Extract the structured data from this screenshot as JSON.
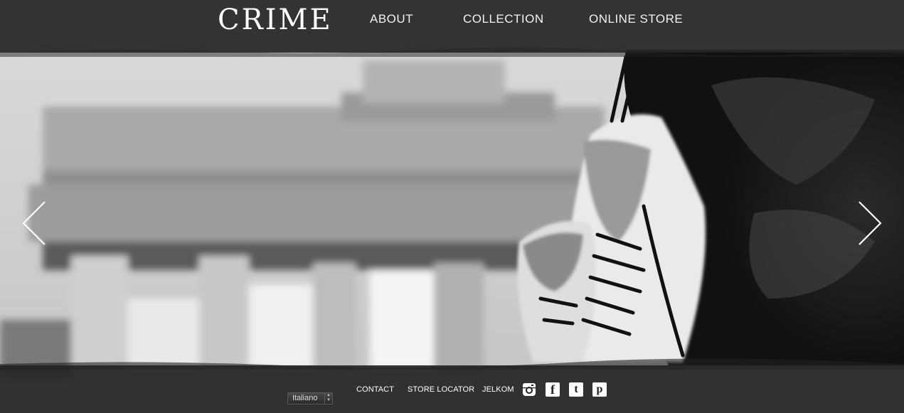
{
  "brand": {
    "logo_text": "CRIME"
  },
  "nav": {
    "items": [
      {
        "label": "ABOUT"
      },
      {
        "label": "COLLECTION"
      },
      {
        "label": "ONLINE STORE"
      }
    ]
  },
  "hero": {
    "image_description_icon": "photo-sneakers-brandenburg-gate",
    "prev_icon": "chevron-left-icon",
    "next_icon": "chevron-right-icon"
  },
  "footer": {
    "language_selected": "Italiano",
    "links": [
      {
        "label": "CONTACT"
      },
      {
        "label": "STORE LOCATOR"
      },
      {
        "label": "JELKOM"
      }
    ],
    "social": [
      {
        "icon": "instagram-icon"
      },
      {
        "icon": "facebook-icon",
        "glyph": "f"
      },
      {
        "icon": "twitter-icon",
        "glyph": "t"
      },
      {
        "icon": "pinterest-icon",
        "glyph": "p"
      }
    ]
  },
  "colors": {
    "bar": "#262626",
    "text": "#ffffff"
  }
}
